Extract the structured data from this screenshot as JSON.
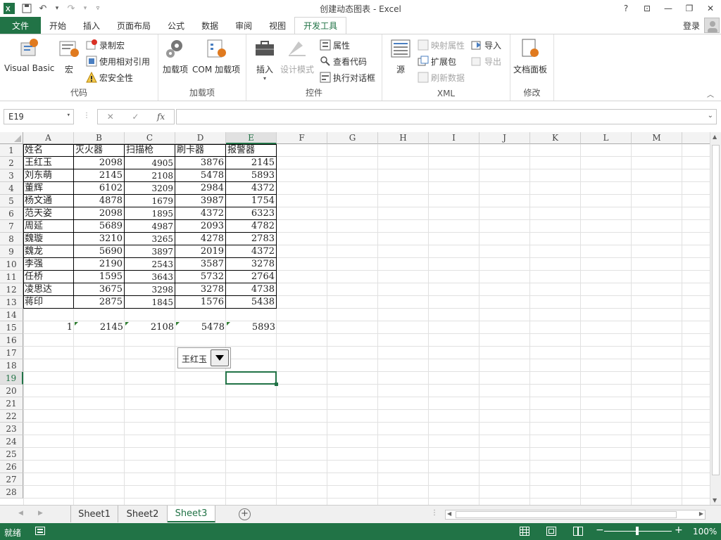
{
  "window": {
    "title": "创建动态图表 - Excel",
    "help": "?",
    "restore_ribbon": "⊡",
    "minimize": "—",
    "maximize": "❐",
    "close": "✕"
  },
  "qat": {
    "undo": "↶",
    "redo": "↷"
  },
  "tabs": {
    "file": "文件",
    "items": [
      "开始",
      "插入",
      "页面布局",
      "公式",
      "数据",
      "审阅",
      "视图"
    ],
    "active": "开发工具"
  },
  "account": {
    "login": "登录"
  },
  "ribbon": {
    "code": {
      "label": "代码",
      "visual_basic": "Visual Basic",
      "macros": "宏",
      "record_macro": "录制宏",
      "relative_ref": "使用相对引用",
      "macro_security": "宏安全性"
    },
    "addins": {
      "label": "加载项",
      "addins": "加载项",
      "com_addins": "COM 加载项"
    },
    "controls": {
      "label": "控件",
      "insert": "插入",
      "design_mode": "设计模式",
      "properties": "属性",
      "view_code": "查看代码",
      "run_dialog": "执行对话框"
    },
    "xml": {
      "label": "XML",
      "source": "源",
      "map_props": "映射属性",
      "expansion": "扩展包",
      "refresh": "刷新数据",
      "import": "导入",
      "export": "导出"
    },
    "modify": {
      "label": "修改",
      "doc_panel": "文档面板"
    }
  },
  "formula_bar": {
    "name_box": "E19",
    "cancel": "✕",
    "enter": "✓",
    "fx": "fx",
    "content": ""
  },
  "columns": [
    "A",
    "B",
    "C",
    "D",
    "E",
    "F",
    "G",
    "H",
    "I",
    "J",
    "K",
    "L",
    "M"
  ],
  "rows": [
    "1",
    "2",
    "3",
    "4",
    "5",
    "6",
    "7",
    "8",
    "9",
    "10",
    "11",
    "12",
    "13",
    "14",
    "15",
    "16",
    "17",
    "18",
    "19",
    "20",
    "21",
    "22",
    "23",
    "24",
    "25",
    "26",
    "27",
    "28"
  ],
  "table": {
    "header": [
      "姓名",
      "灭火器",
      "扫描枪",
      "刷卡器",
      "报警器"
    ],
    "data": [
      [
        "王红玉",
        "2098",
        "4905",
        "3876",
        "2145"
      ],
      [
        "刘东萌",
        "2145",
        "2108",
        "5478",
        "5893"
      ],
      [
        "董辉",
        "6102",
        "3209",
        "2984",
        "4372"
      ],
      [
        "杨文通",
        "4878",
        "1679",
        "3987",
        "1754"
      ],
      [
        "范天姿",
        "2098",
        "1895",
        "4372",
        "6323"
      ],
      [
        "周延",
        "5689",
        "4987",
        "2093",
        "4782"
      ],
      [
        "魏璇",
        "3210",
        "3265",
        "4278",
        "2783"
      ],
      [
        "魏龙",
        "5690",
        "3897",
        "2019",
        "4372"
      ],
      [
        "李强",
        "2190",
        "2543",
        "3587",
        "3278"
      ],
      [
        "任桥",
        "1595",
        "3643",
        "5732",
        "2764"
      ],
      [
        "凌思达",
        "3675",
        "3298",
        "3278",
        "4738"
      ],
      [
        "蒋印",
        "2875",
        "1845",
        "1576",
        "5438"
      ]
    ]
  },
  "row15": [
    "1",
    "2145",
    "2108",
    "5478",
    "5893"
  ],
  "combo": {
    "value": "王红玉"
  },
  "sheets": [
    "Sheet1",
    "Sheet2",
    "Sheet3"
  ],
  "active_sheet": "Sheet3",
  "status": {
    "ready": "就绪",
    "zoom": "100%",
    "minus": "−",
    "plus": "+"
  },
  "colors": {
    "accent": "#217346"
  }
}
